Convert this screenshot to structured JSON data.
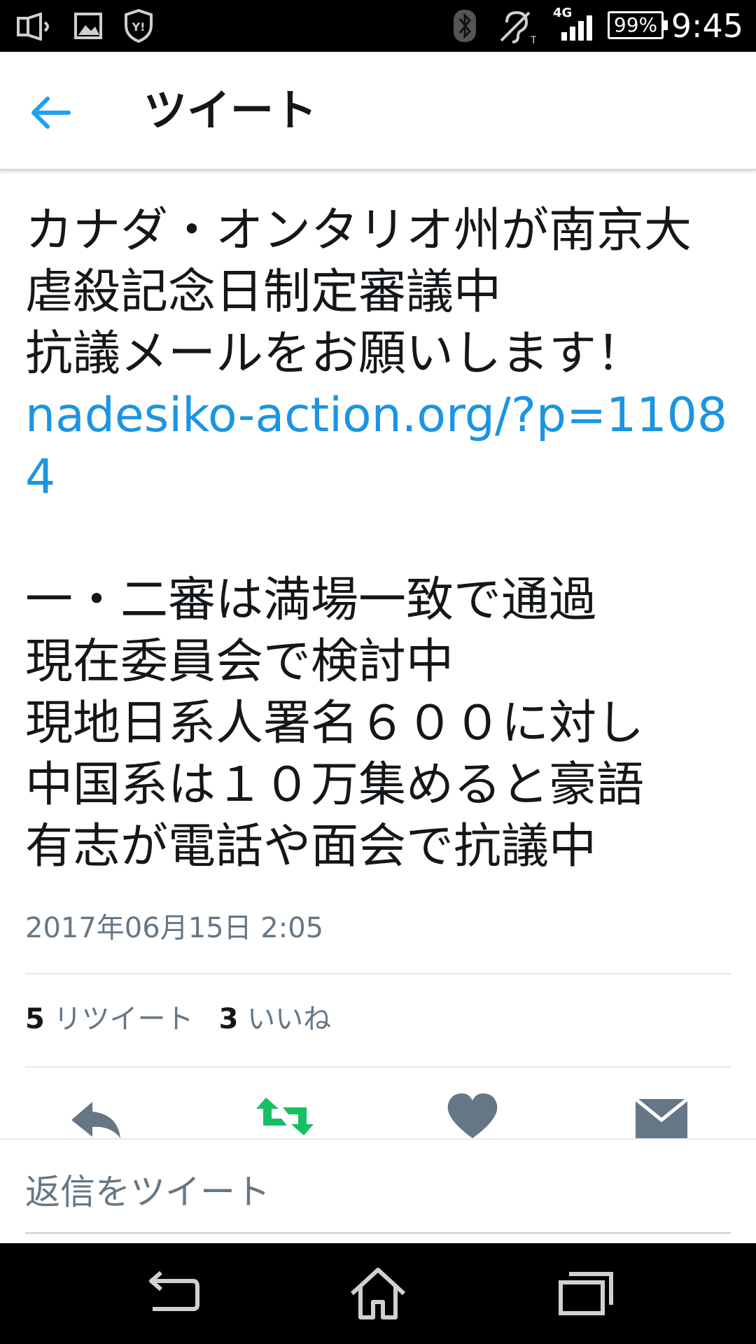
{
  "status_bar": {
    "time": "9:45",
    "battery": "99%",
    "network": "4G",
    "icons": [
      "speaker-icon",
      "image-icon",
      "shield-y-icon",
      "bluetooth-icon",
      "hearing-aid-icon",
      "signal-icon",
      "battery-icon"
    ]
  },
  "top_bar": {
    "title": "ツイート",
    "back_icon": "back-arrow-icon"
  },
  "tweet": {
    "text_before_link": "カナダ・オンタリオ州が南京大虐殺記念日制定審議中\n抗議メールをお願いします！\n",
    "link_text": "nadesiko-action.org/?p=11084",
    "text_after_link": "\n\n一・二審は満場一致で通過\n現在委員会で検討中\n現地日系人署名６００に対し\n中国系は１０万集めると豪語\n有志が電話や面会で抗議中",
    "timestamp": "2017年06月15日 2:05",
    "retweet_count": "5",
    "retweet_label": "リツイート",
    "like_count": "3",
    "like_label": "いいね"
  },
  "actions": {
    "icons": [
      "reply-icon",
      "retweet-icon",
      "like-icon",
      "direct-message-icon"
    ],
    "retweet_active_color": "#17bf63",
    "icon_color": "#657786"
  },
  "reply": {
    "placeholder": "返信をツイート"
  },
  "colors": {
    "accent": "#1b95e0",
    "text": "#14171a",
    "secondary": "#657786"
  }
}
